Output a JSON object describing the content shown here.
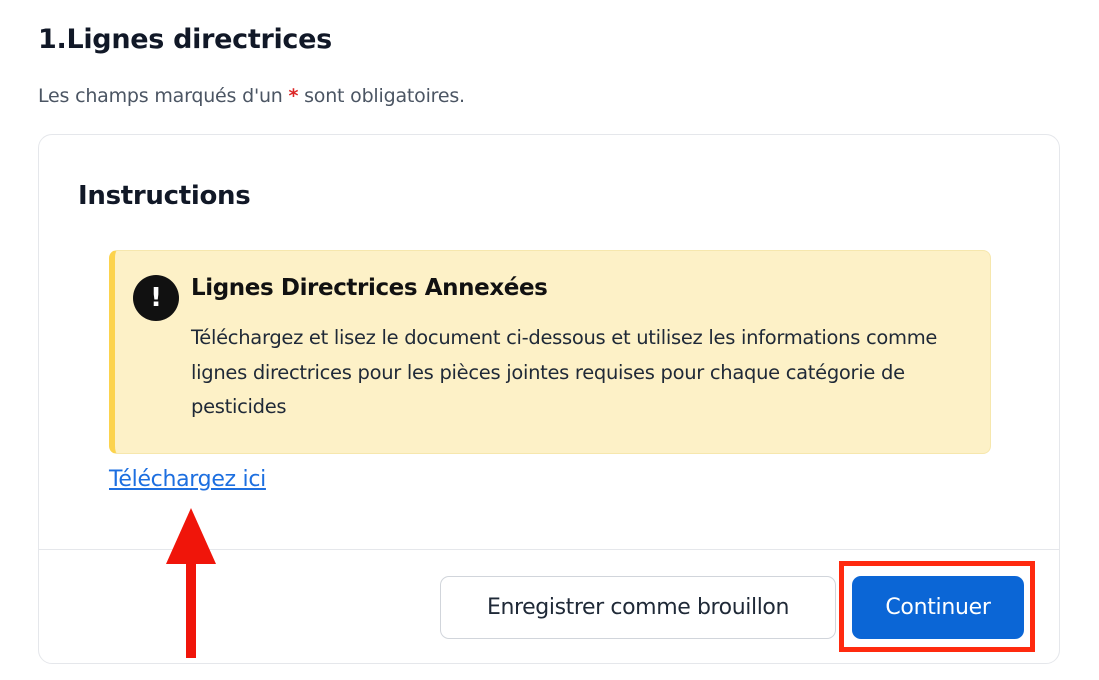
{
  "section": {
    "title": "1.Lignes directrices",
    "required_note_prefix": "Les champs marqués d'un ",
    "required_marker": "*",
    "required_note_suffix": " sont obligatoires."
  },
  "card": {
    "title": "Instructions",
    "alert": {
      "icon": "exclamation-icon",
      "icon_glyph": "!",
      "title": "Lignes Directrices Annexées",
      "body": "Téléchargez et lisez le document ci-dessous et utilisez les informations comme lignes directrices pour les pièces jointes requises pour chaque catégorie de pesticides",
      "accent_color": "#fcd34d",
      "background_color": "#fdf1c7"
    },
    "download_link": "Téléchargez ici"
  },
  "actions": {
    "draft_label": "Enregistrer comme brouillon",
    "continue_label": "Continuer",
    "primary_color": "#0b66d6"
  },
  "annotations": {
    "highlight_color": "#ff2a0f",
    "arrow_color": "#f0150a"
  }
}
